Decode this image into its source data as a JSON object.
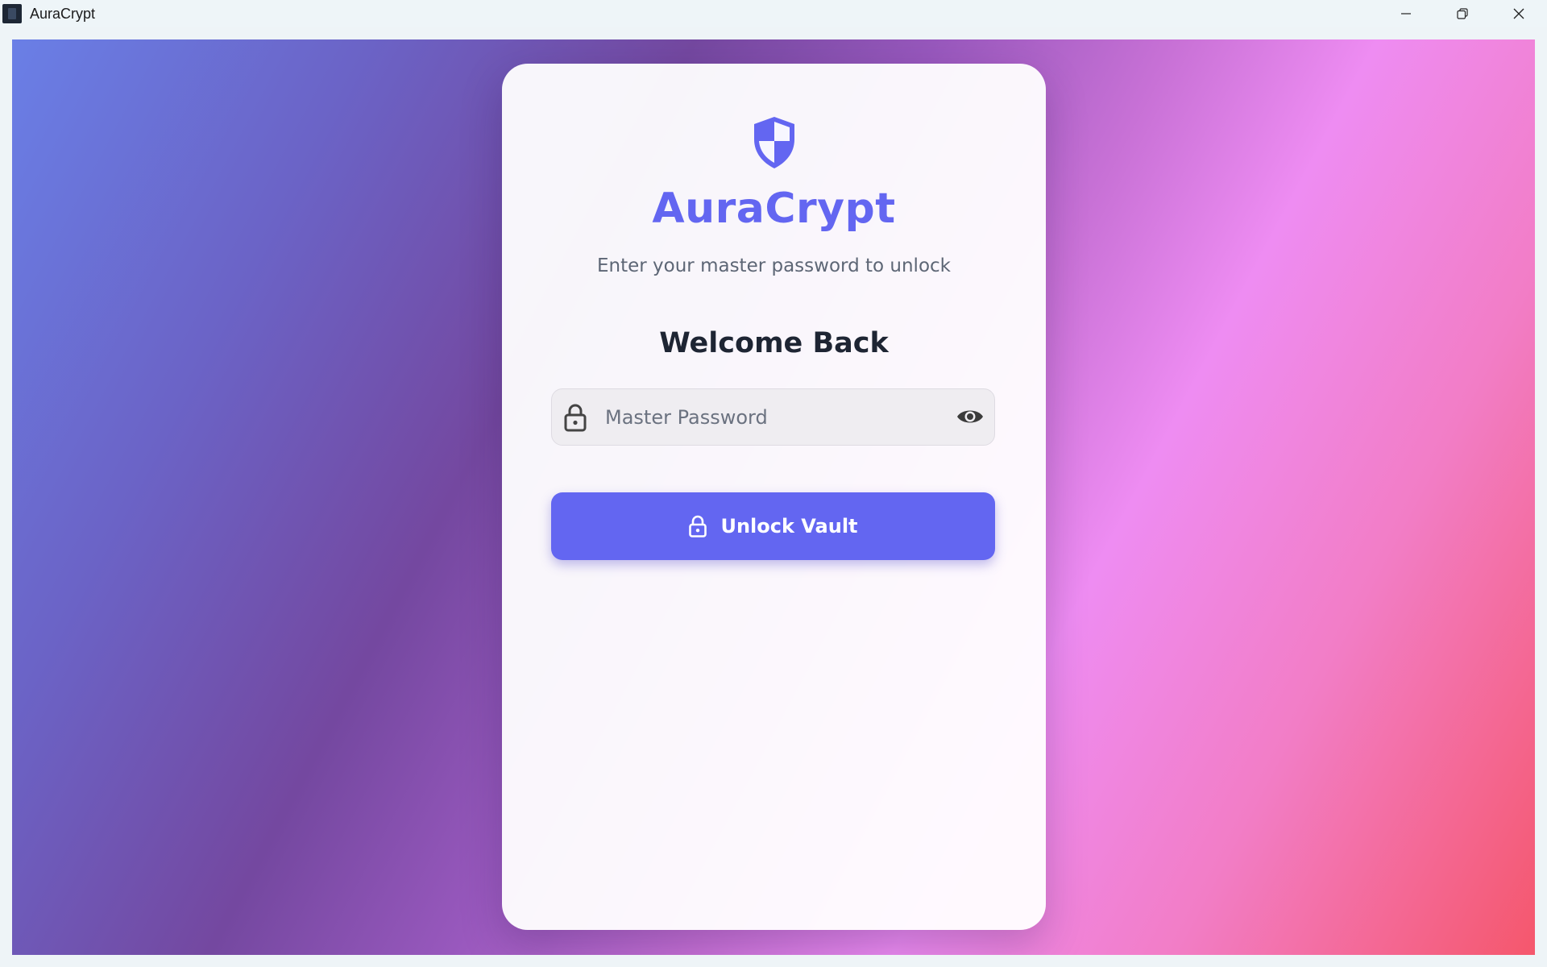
{
  "window": {
    "title": "AuraCrypt",
    "controls": {
      "minimize": "minimize-icon",
      "restore": "restore-icon",
      "close": "close-icon"
    }
  },
  "login": {
    "logo_icon": "shield-icon",
    "brand": "AuraCrypt",
    "subtitle": "Enter your master password to unlock",
    "heading": "Welcome Back",
    "password_field": {
      "placeholder": "Master Password",
      "value": "",
      "leading_icon": "lock-icon",
      "trailing_icon": "eye-icon"
    },
    "unlock_button": {
      "label": "Unlock Vault",
      "icon": "lock-icon"
    }
  },
  "colors": {
    "accent": "#6366f1",
    "gradient_start": "#6a7fe6",
    "gradient_mid": "#7448a0",
    "gradient_pink": "#ee8cf2",
    "gradient_end": "#f5576c"
  }
}
